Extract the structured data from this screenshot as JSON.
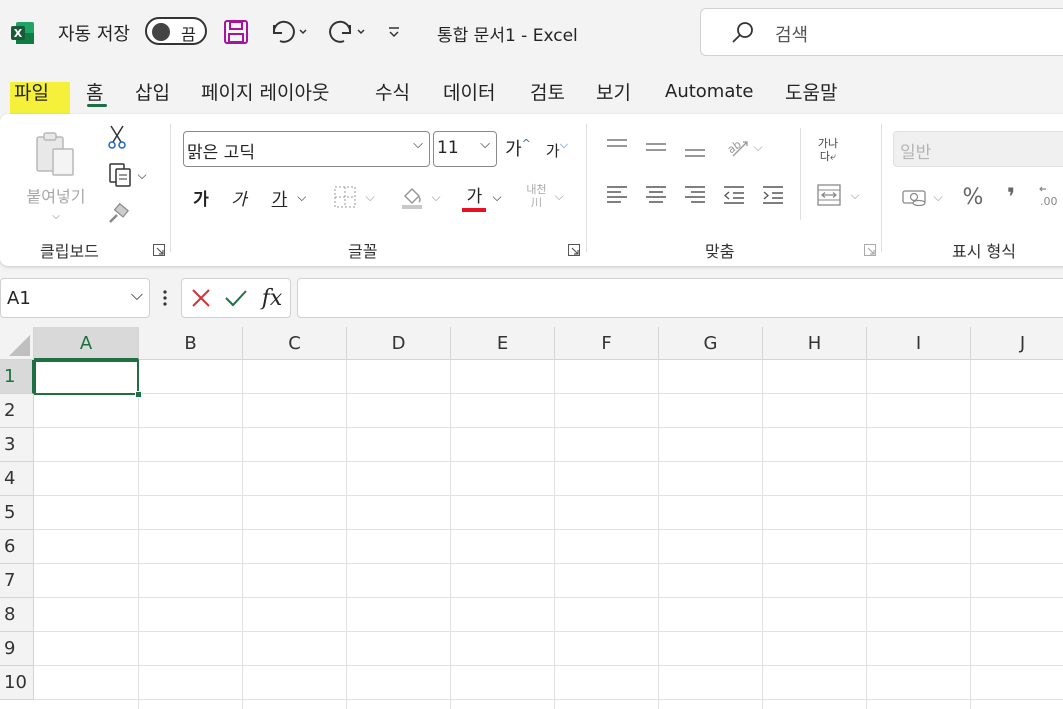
{
  "titlebar": {
    "autosave_label": "자동 저장",
    "autosave_state": "끔",
    "doc_title": "통합 문서1  -  Excel",
    "search_placeholder": "검색",
    "icons": [
      "excel-logo-icon",
      "save-icon",
      "undo-icon",
      "redo-icon",
      "customize-qat-icon",
      "search-icon"
    ]
  },
  "tabs": [
    {
      "label": "파일"
    },
    {
      "label": "홈"
    },
    {
      "label": "삽입"
    },
    {
      "label": "페이지 레이아웃"
    },
    {
      "label": "수식"
    },
    {
      "label": "데이터"
    },
    {
      "label": "검토"
    },
    {
      "label": "보기"
    },
    {
      "label": "Automate"
    },
    {
      "label": "도움말"
    }
  ],
  "active_tab": "홈",
  "highlighted_tab": "파일",
  "ribbon": {
    "clipboard": {
      "group_label": "클립보드",
      "paste_label": "붙여넣기"
    },
    "font": {
      "group_label": "글꼴",
      "font_name": "맑은 고딕",
      "font_size": "11",
      "increase_label": "가",
      "decrease_label": "가",
      "bold_label": "가",
      "italic_label": "가",
      "underline_label": "가",
      "font_color_label": "가",
      "phonetic_label_top": "내천",
      "phonetic_label_bottom": "川"
    },
    "alignment": {
      "group_label": "맞춤",
      "wrap_label_top": "가나",
      "wrap_label_bottom": "다⤶"
    },
    "number": {
      "group_label": "표시 형식",
      "format_value": "일반",
      "percent_label": "%",
      "comma_label": "❜"
    }
  },
  "formula_bar": {
    "name_box": "A1",
    "fx_label": "fx",
    "formula_value": ""
  },
  "columns": [
    "A",
    "B",
    "C",
    "D",
    "E",
    "F",
    "G",
    "H",
    "I",
    "J"
  ],
  "rows": [
    "1",
    "2",
    "3",
    "4",
    "5",
    "6",
    "7",
    "8",
    "9",
    "10"
  ],
  "selected_cell": "A1",
  "colors": {
    "accent": "#1e6f41",
    "highlight": "#f5f03a",
    "font_color_bar": "#e81123",
    "excel_green": "#107c41"
  }
}
